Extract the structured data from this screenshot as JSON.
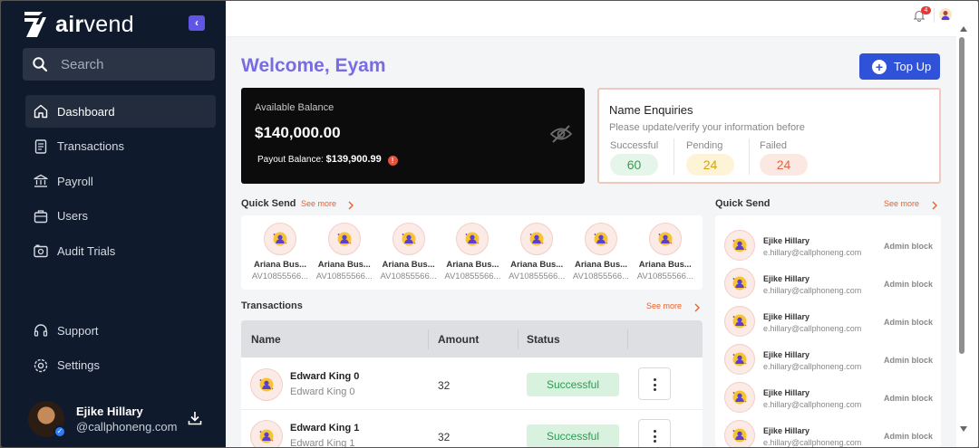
{
  "brand": {
    "logo_text_bold": "air",
    "logo_text_light": "vend",
    "accent": "#6155e6"
  },
  "sidebar": {
    "search_placeholder": "Search",
    "items": [
      {
        "label": "Dashboard",
        "icon": "home-icon",
        "active": true
      },
      {
        "label": "Transactions",
        "icon": "document-icon"
      },
      {
        "label": "Payroll",
        "icon": "bank-icon"
      },
      {
        "label": "Users",
        "icon": "briefcase-icon"
      },
      {
        "label": "Audit Trials",
        "icon": "camera-icon"
      }
    ],
    "bottom_items": [
      {
        "label": "Support",
        "icon": "headset-icon"
      },
      {
        "label": "Settings",
        "icon": "gear-icon"
      }
    ],
    "user": {
      "name": "Ejike Hillary",
      "email": "@callphoneng.com"
    }
  },
  "topbar": {
    "notification_count": "4"
  },
  "main": {
    "welcome": "Welcome, Eyam",
    "topup_label": "Top Up",
    "balance": {
      "label": "Available Balance",
      "value": "$140,000.00",
      "payout_label": "Payout Balance:",
      "payout_value": "$139,900.99"
    },
    "enquiries": {
      "title": "Name Enquiries",
      "subtitle": "Please update/verify your information before",
      "stats": [
        {
          "label": "Successful",
          "value": "60",
          "bg": "#e6f5ea",
          "color": "#3c9a52"
        },
        {
          "label": "Pending",
          "value": "24",
          "bg": "#fdf4d8",
          "color": "#d4a017"
        },
        {
          "label": "Failed",
          "value": "24",
          "bg": "#fce8e3",
          "color": "#e0653e"
        }
      ]
    },
    "quick_send": {
      "title": "Quick Send",
      "see_more": "See more",
      "items": [
        {
          "name": "Ariana Bus...",
          "id": "AV10855566..."
        },
        {
          "name": "Ariana Bus...",
          "id": "AV10855566..."
        },
        {
          "name": "Ariana Bus...",
          "id": "AV10855566..."
        },
        {
          "name": "Ariana Bus...",
          "id": "AV10855566..."
        },
        {
          "name": "Ariana Bus...",
          "id": "AV10855566..."
        },
        {
          "name": "Ariana Bus...",
          "id": "AV10855566..."
        },
        {
          "name": "Ariana Bus...",
          "id": "AV10855566..."
        }
      ]
    },
    "transactions": {
      "title": "Transactions",
      "see_more": "See more",
      "columns": [
        "Name",
        "Amount",
        "Status"
      ],
      "rows": [
        {
          "name": "Edward King 0",
          "sub": "Edward King 0",
          "amount": "32",
          "status": "Successful"
        },
        {
          "name": "Edward King 1",
          "sub": "Edward King 1",
          "amount": "32",
          "status": "Successful"
        }
      ]
    },
    "quick_send_list": {
      "title": "Quick Send",
      "see_more": "See more",
      "rows": [
        {
          "name": "Ejike Hillary",
          "email": "e.hillary@callphoneng.com",
          "action": "Admin block"
        },
        {
          "name": "Ejike Hillary",
          "email": "e.hillary@callphoneng.com",
          "action": "Admin block"
        },
        {
          "name": "Ejike Hillary",
          "email": "e.hillary@callphoneng.com",
          "action": "Admin block"
        },
        {
          "name": "Ejike Hillary",
          "email": "e.hillary@callphoneng.com",
          "action": "Admin block"
        },
        {
          "name": "Ejike Hillary",
          "email": "e.hillary@callphoneng.com",
          "action": "Admin block"
        },
        {
          "name": "Ejike Hillary",
          "email": "e.hillary@callphoneng.com",
          "action": "Admin block"
        }
      ]
    }
  }
}
